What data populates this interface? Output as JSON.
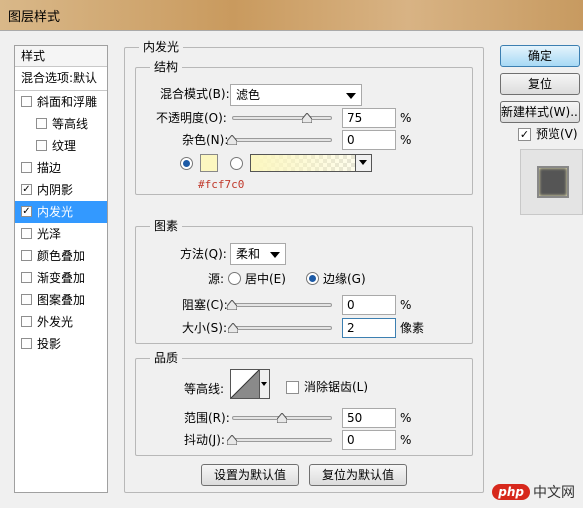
{
  "window": {
    "title": "图层样式"
  },
  "styles_panel": {
    "header": "样式",
    "blend_options": "混合选项:默认",
    "items": [
      {
        "label": "斜面和浮雕",
        "checked": false,
        "sub": false
      },
      {
        "label": "等高线",
        "checked": false,
        "sub": true
      },
      {
        "label": "纹理",
        "checked": false,
        "sub": true
      },
      {
        "label": "描边",
        "checked": false,
        "sub": false
      },
      {
        "label": "内阴影",
        "checked": true,
        "sub": false
      },
      {
        "label": "内发光",
        "checked": true,
        "sub": false,
        "selected": true
      },
      {
        "label": "光泽",
        "checked": false,
        "sub": false
      },
      {
        "label": "颜色叠加",
        "checked": false,
        "sub": false
      },
      {
        "label": "渐变叠加",
        "checked": false,
        "sub": false
      },
      {
        "label": "图案叠加",
        "checked": false,
        "sub": false
      },
      {
        "label": "外发光",
        "checked": false,
        "sub": false
      },
      {
        "label": "投影",
        "checked": false,
        "sub": false
      }
    ]
  },
  "inner_glow": {
    "title": "内发光",
    "structure": {
      "title": "结构",
      "blend_mode_label": "混合模式(B):",
      "blend_mode_value": "滤色",
      "opacity_label": "不透明度(O):",
      "opacity_value": "75",
      "opacity_unit": "%",
      "opacity_fraction": 0.75,
      "noise_label": "杂色(N):",
      "noise_value": "0",
      "noise_unit": "%",
      "noise_fraction": 0,
      "color_hex": "#fcf7c0",
      "color_hex_label": "#fcf7c0"
    },
    "elements": {
      "title": "图素",
      "method_label": "方法(Q):",
      "method_value": "柔和",
      "source_label": "源:",
      "source_center": "居中(E)",
      "source_edge": "边缘(G)",
      "choke_label": "阻塞(C):",
      "choke_value": "0",
      "choke_unit": "%",
      "choke_fraction": 0,
      "size_label": "大小(S):",
      "size_value": "2",
      "size_unit": "像素",
      "size_fraction": 0.01
    },
    "quality": {
      "title": "品质",
      "contour_label": "等高线:",
      "antialias_label": "消除锯齿(L)",
      "range_label": "范围(R):",
      "range_value": "50",
      "range_unit": "%",
      "range_fraction": 0.5,
      "jitter_label": "抖动(J):",
      "jitter_value": "0",
      "jitter_unit": "%",
      "jitter_fraction": 0
    },
    "make_default": "设置为默认值",
    "reset_default": "复位为默认值"
  },
  "right_buttons": {
    "ok": "确定",
    "reset": "复位",
    "new_style": "新建样式(W)...",
    "preview": "预览(V)",
    "preview_checked": true
  },
  "watermark": {
    "badge": "php",
    "text": "中文网"
  },
  "colors": {
    "selection": "#3399ff",
    "glow": "#fcf7c0",
    "hex_text": "#c0392b"
  }
}
